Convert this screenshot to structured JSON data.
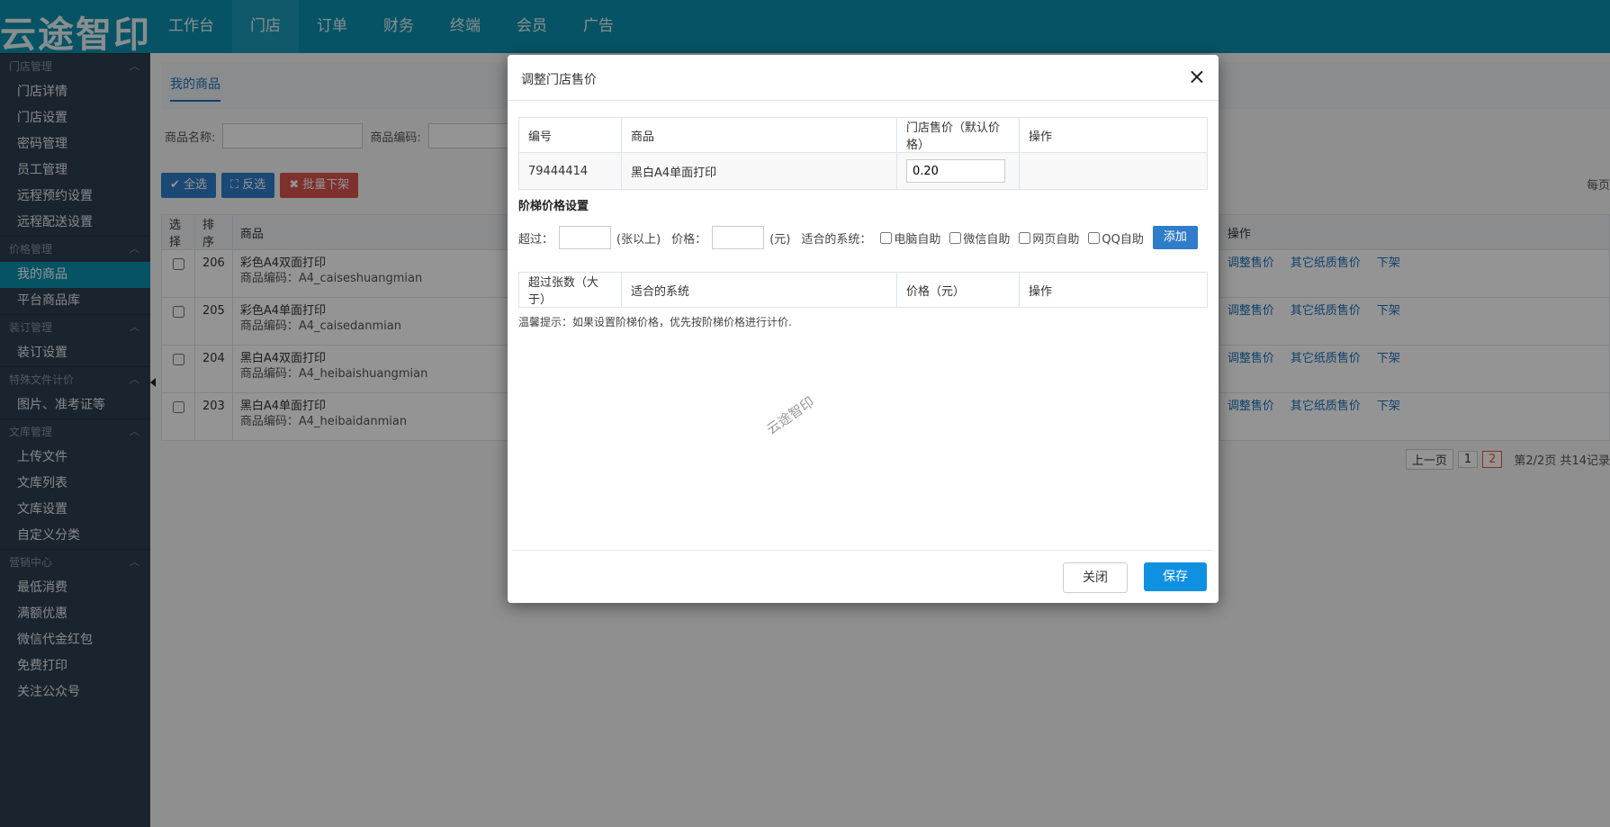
{
  "app": {
    "logo": "云途智印"
  },
  "nav": [
    "工作台",
    "门店",
    "订单",
    "财务",
    "终端",
    "会员",
    "广告"
  ],
  "sidebar": [
    {
      "title": "门店管理",
      "items": [
        "门店详情",
        "门店设置",
        "密码管理",
        "员工管理",
        "远程预约设置",
        "远程配送设置"
      ]
    },
    {
      "title": "价格管理",
      "items": [
        "我的商品",
        "平台商品库"
      ]
    },
    {
      "title": "装订管理",
      "items": [
        "装订设置"
      ]
    },
    {
      "title": "特殊文件计价",
      "items": [
        "图片、准考证等"
      ]
    },
    {
      "title": "文库管理",
      "items": [
        "上传文件",
        "文库列表",
        "文库设置",
        "自定义分类"
      ]
    },
    {
      "title": "营销中心",
      "items": [
        "最低消费",
        "满额优惠",
        "微信代金红包",
        "免费打印",
        "关注公众号"
      ]
    }
  ],
  "main": {
    "tab": "我的商品",
    "filters": {
      "name_label": "商品名称:",
      "code_label": "商品编码:"
    },
    "buttons": {
      "select_all": "✔ 全选",
      "invert": "⛶ 反选",
      "batch_off": "✖ 批量下架"
    },
    "per_page_label": "每页",
    "table": {
      "headers": [
        "选择",
        "排序",
        "商品",
        "操作"
      ],
      "rows": [
        {
          "sort": "206",
          "name": "彩色A4双面打印",
          "code": "商品编码：A4_caiseshuangmian"
        },
        {
          "sort": "205",
          "name": "彩色A4单面打印",
          "code": "商品编码：A4_caisedanmian"
        },
        {
          "sort": "204",
          "name": "黑白A4双面打印",
          "code": "商品编码：A4_heibaishuangmian"
        },
        {
          "sort": "203",
          "name": "黑白A4单面打印",
          "code": "商品编码：A4_heibaidanmian"
        }
      ],
      "ops": [
        "调整售价",
        "其它纸质售价",
        "下架"
      ]
    },
    "pager": {
      "prev": "上一页",
      "pages": [
        "1",
        "2"
      ],
      "current": "2",
      "info": "第2/2页 共14记录"
    }
  },
  "modal": {
    "title": "调整门店售价",
    "close_icon": "×",
    "price_table": {
      "headers": [
        "编号",
        "商品",
        "门店售价（默认价格）",
        "操作"
      ],
      "row": {
        "id": "79444414",
        "product": "黑白A4单面打印",
        "price": "0.20"
      }
    },
    "tier": {
      "title": "阶梯价格设置",
      "exceed_label": "超过：",
      "unit_label": "(张以上)",
      "price_label": "价格：",
      "yuan_label": "(元)",
      "system_label": "适合的系统：",
      "systems": [
        "电脑自助",
        "微信自助",
        "网页自助",
        "QQ自助"
      ],
      "add_label": "添加",
      "headers": [
        "超过张数（大于）",
        "适合的系统",
        "价格（元）",
        "操作"
      ]
    },
    "hint": "温馨提示：如果设置阶梯价格，优先按阶梯价格进行计价.",
    "watermark": "云途智印",
    "close_label": "关闭",
    "save_label": "保存"
  }
}
